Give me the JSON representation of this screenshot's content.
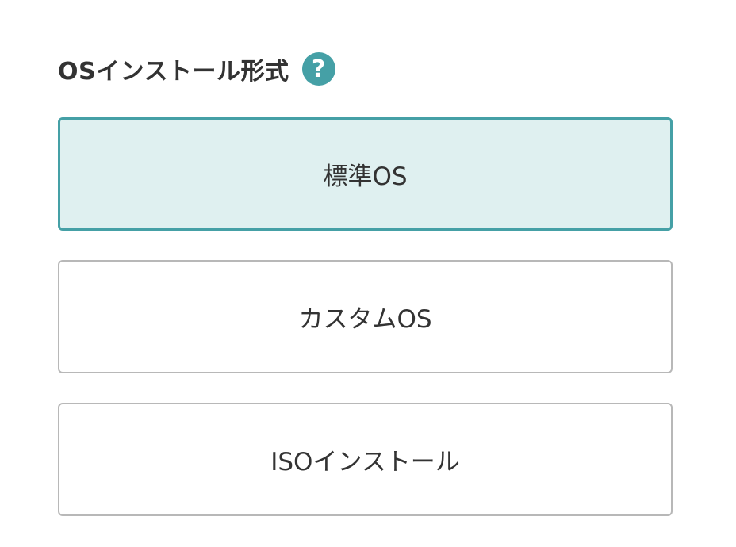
{
  "section": {
    "title": "OSインストール形式",
    "help_icon": "help-circle-icon",
    "help_glyph": "?"
  },
  "colors": {
    "accent": "#45a0a6",
    "selected_background": "#dff0f0",
    "border": "#b8b8b8",
    "text": "#333333"
  },
  "options": [
    {
      "label": "標準OS",
      "selected": true
    },
    {
      "label": "カスタムOS",
      "selected": false
    },
    {
      "label": "ISOインストール",
      "selected": false
    }
  ]
}
